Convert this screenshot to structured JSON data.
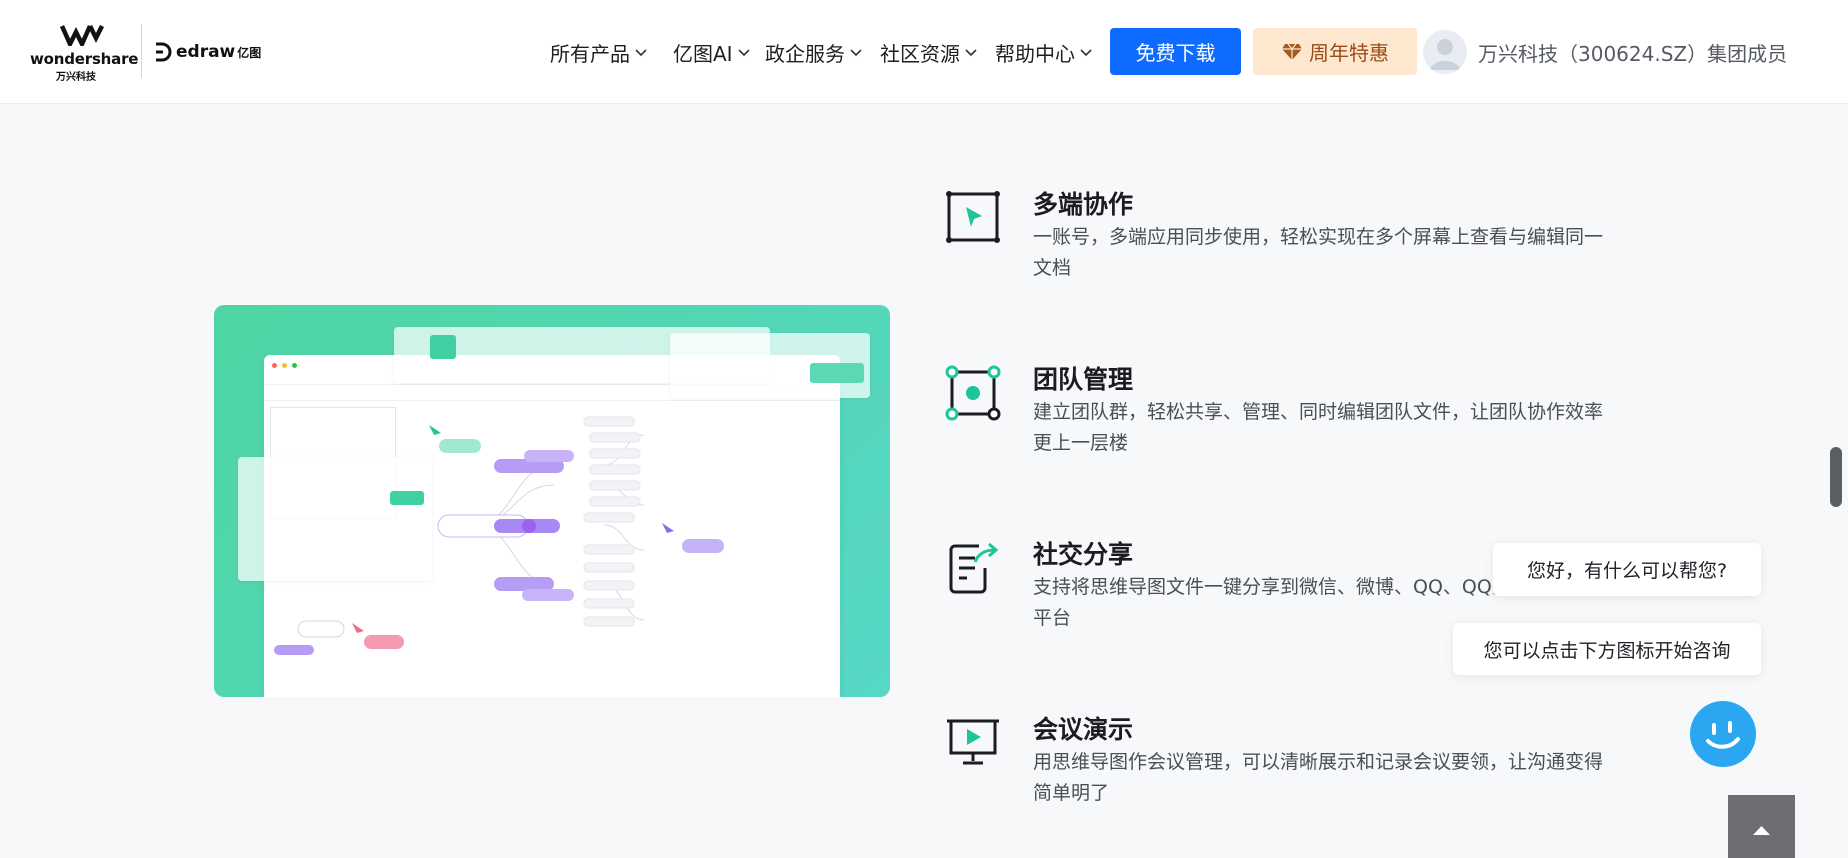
{
  "header": {
    "brand_text": "wondershare",
    "brand_cn": "万兴科技",
    "product_text": "edraw",
    "product_cn": "亿图",
    "nav": [
      {
        "label": "所有产品"
      },
      {
        "label": "亿图AI"
      },
      {
        "label": "政企服务"
      },
      {
        "label": "社区资源"
      },
      {
        "label": "帮助中心"
      }
    ],
    "download_label": "免费下载",
    "promo_label": "周年特惠",
    "company_text": "万兴科技（300624.SZ）集团成员"
  },
  "features": [
    {
      "title": "多端协作",
      "desc": "一账号，多端应用同步使用，轻松实现在多个屏幕上查看与编辑同一文档"
    },
    {
      "title": "团队管理",
      "desc": "建立团队群，轻松共享、管理、同时编辑团队文件，让团队协作效率更上一层楼"
    },
    {
      "title": "社交分享",
      "desc": "支持将思维导图文件一键分享到微信、微博、QQ、QQ空间等社交平台"
    },
    {
      "title": "会议演示",
      "desc": "用思维导图作会议管理，可以清晰展示和记录会议要领，让沟通变得简单明了"
    }
  ],
  "chat": {
    "greeting": "您好，有什么可以帮您?",
    "hint": "您可以点击下方图标开始咨询"
  },
  "colors": {
    "accent_blue": "#0d6cff",
    "promo_bg": "#fde8cf",
    "icon_green": "#1fc59a",
    "illus_green": "#4fd5a3",
    "chat_blue": "#2aa7f0"
  },
  "icons": {
    "download": "none",
    "promo": "diamond-icon",
    "feature_1": "cursor-frame-icon",
    "feature_2": "team-node-icon",
    "feature_3": "share-doc-icon",
    "feature_4": "presentation-icon",
    "chat": "smile-chat-icon",
    "to_top": "arrow-up-icon"
  }
}
